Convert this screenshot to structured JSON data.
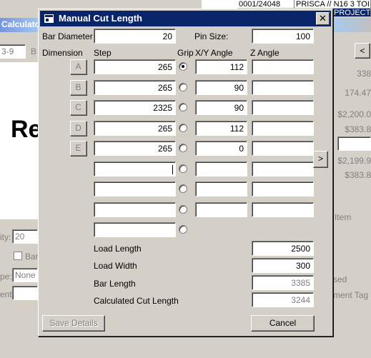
{
  "background": {
    "title_fragment": "Calculato",
    "grid_cells": [
      "0001/24048",
      "PRISCA // N16 3 TOI",
      "PROJECT"
    ],
    "field_fragment": "3-9",
    "label_b": "B",
    "big_text": "Re",
    "qty_label": "ity:",
    "qty_value": "20",
    "bar_check_label": "Bar",
    "type_label": "pe:",
    "type_value": "None",
    "ent_label": "ent:",
    "right_values": [
      "338",
      "174.47",
      "$2,200.0",
      "$383.8",
      "$2,199.9",
      "$383.8"
    ],
    "view_item": "w Item",
    "sed": "sed",
    "comment_tag": "mment Tag"
  },
  "dialog": {
    "title": "Manual Cut Length",
    "close_glyph": "✕",
    "bar_diameter_label": "Bar Diameter",
    "bar_diameter_value": "20",
    "pin_size_label": "Pin Size:",
    "pin_size_value": "100",
    "headers": {
      "dimension": "Dimension",
      "step": "Step",
      "grip": "Grip",
      "xy_angle": "X/Y Angle",
      "z_angle": "Z Angle"
    },
    "rows": [
      {
        "dim": "A",
        "step": "265",
        "xy": "112",
        "z": ""
      },
      {
        "dim": "B",
        "step": "265",
        "xy": "90",
        "z": ""
      },
      {
        "dim": "C",
        "step": "2325",
        "xy": "90",
        "z": ""
      },
      {
        "dim": "D",
        "step": "265",
        "xy": "112",
        "z": ""
      },
      {
        "dim": "E",
        "step": "265",
        "xy": "0",
        "z": ""
      },
      {
        "dim": "",
        "step": "",
        "xy": "",
        "z": ""
      },
      {
        "dim": "",
        "step": "",
        "xy": "",
        "z": ""
      },
      {
        "dim": "",
        "step": "",
        "xy": "",
        "z": ""
      },
      {
        "dim": "",
        "step": "",
        "xy": "",
        "z": ""
      }
    ],
    "grip_selected_row": 0,
    "load_length_label": "Load Length",
    "load_length_value": "2500",
    "load_width_label": "Load Width",
    "load_width_value": "300",
    "bar_length_label": "Bar Length",
    "bar_length_value": "3385",
    "calc_cut_length_label": "Calculated Cut Length",
    "calc_cut_length_value": "3244",
    "save_label": "Save Details",
    "cancel_label": "Cancel",
    "next_glyph": ">",
    "prev_glyph": "<"
  }
}
